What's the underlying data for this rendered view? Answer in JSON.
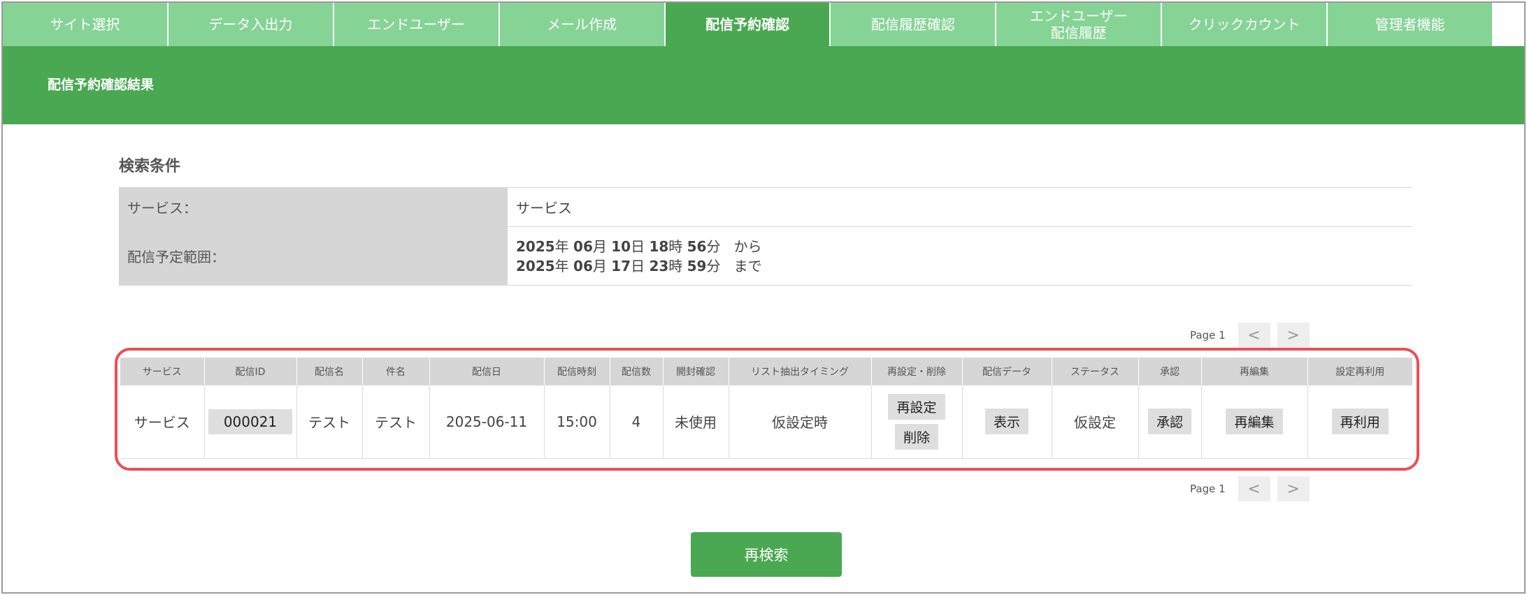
{
  "nav": {
    "tabs": [
      {
        "label": "サイト選択"
      },
      {
        "label": "データ入出力"
      },
      {
        "label": "エンドユーザー"
      },
      {
        "label": "メール作成"
      },
      {
        "label": "配信予約確認"
      },
      {
        "label": "配信履歴確認"
      },
      {
        "label": "エンドユーザー\n配信履歴"
      },
      {
        "label": "クリックカウント"
      },
      {
        "label": "管理者機能"
      }
    ],
    "active_index": 4
  },
  "header": {
    "title": "配信予約確認結果"
  },
  "search": {
    "title": "検索条件",
    "service_label": "サービス：",
    "service_value": "サービス",
    "range_label": "配信予定範囲：",
    "from": {
      "year": "2025",
      "month": "06",
      "day": "10",
      "hour": "18",
      "minute": "56",
      "suffix": "から"
    },
    "to": {
      "year": "2025",
      "month": "06",
      "day": "17",
      "hour": "23",
      "minute": "59",
      "suffix": "まで"
    },
    "units": {
      "year": "年",
      "month": "月",
      "day": "日",
      "hour": "時",
      "minute": "分"
    }
  },
  "pager": {
    "label": "Page 1",
    "prev": "<",
    "next": ">"
  },
  "table": {
    "headers": [
      "サービス",
      "配信ID",
      "配信名",
      "件名",
      "配信日",
      "配信時刻",
      "配信数",
      "開封確認",
      "リスト抽出タイミング",
      "再設定・削除",
      "配信データ",
      "ステータス",
      "承認",
      "再編集",
      "設定再利用"
    ],
    "row": {
      "service": "サービス",
      "delivery_id": "000021",
      "delivery_name": "テスト",
      "subject": "テスト",
      "date": "2025-06-11",
      "time": "15:00",
      "count": "4",
      "open_check": "未使用",
      "extract_timing": "仮設定時",
      "reset_label": "再設定",
      "delete_label": "削除",
      "show_label": "表示",
      "status": "仮設定",
      "approve_label": "承認",
      "reedit_label": "再編集",
      "reuse_label": "再利用"
    }
  },
  "research_label": "再検索",
  "colors": {
    "nav_tab": "#86d396",
    "nav_active": "#4aa853",
    "header": "#4aa853",
    "highlight": "#ec4e55"
  }
}
